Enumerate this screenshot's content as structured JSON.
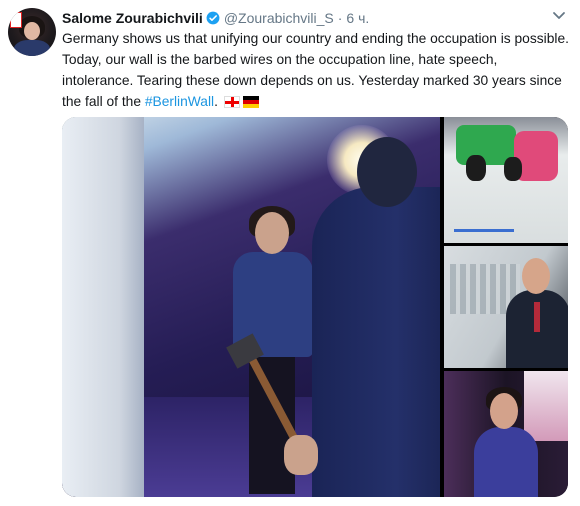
{
  "author": {
    "name": "Salome Zourabichvili",
    "handle": "@Zourabichvili_S",
    "separator": "·",
    "time": "6 ч."
  },
  "tweet": {
    "text": "Germany shows us that unifying our country and ending the occupation is possible. Today, our wall is the barbed wires on the occupation line, hate speech, intolerance. Tearing these down depends on us. Yesterday marked 30 years since the fall of the ",
    "hashtag": "#BerlinWall",
    "after_hashtag": ".",
    "flags": [
      "georgia-flag",
      "germany-flag"
    ]
  },
  "colors": {
    "link": "#1b95e0",
    "verified": "#1da1f2",
    "muted": "#657786"
  }
}
